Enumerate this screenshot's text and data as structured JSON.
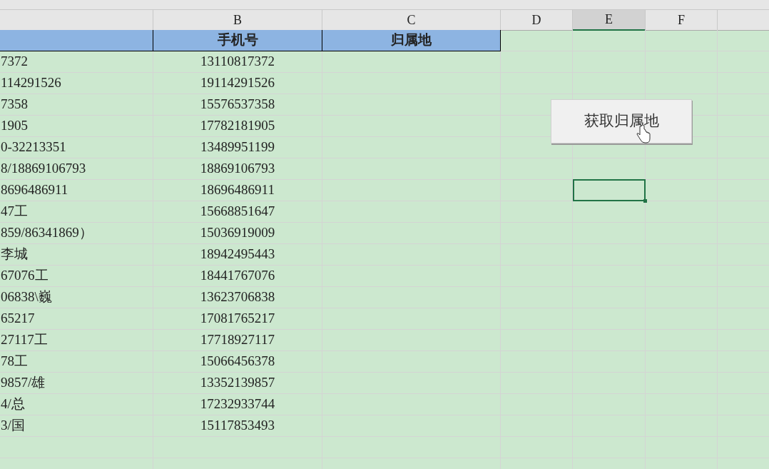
{
  "column_headers": [
    {
      "label": "B",
      "selected": false
    },
    {
      "label": "C",
      "selected": false
    },
    {
      "label": "D",
      "selected": false
    },
    {
      "label": "E",
      "selected": true
    },
    {
      "label": "F",
      "selected": false
    }
  ],
  "header_row": {
    "column_b": "手机号",
    "column_c": "归属地"
  },
  "rows": [
    {
      "column_a": "7372",
      "phone": "13110817372",
      "e_selected": false
    },
    {
      "column_a": "114291526",
      "phone": "19114291526",
      "e_selected": false
    },
    {
      "column_a": "7358",
      "phone": "15576537358",
      "e_selected": false
    },
    {
      "column_a": "1905",
      "phone": "17782181905",
      "e_selected": false
    },
    {
      "column_a": "0-32213351",
      "phone": "13489951199",
      "e_selected": false
    },
    {
      "column_a": "8/18869106793",
      "phone": "18869106793",
      "e_selected": false
    },
    {
      "column_a": "8696486911",
      "phone": "18696486911",
      "e_selected": true
    },
    {
      "column_a": "47工",
      "phone": "15668851647",
      "e_selected": false
    },
    {
      "column_a": "859/86341869）",
      "phone": "15036919009",
      "e_selected": false
    },
    {
      "column_a": "李城",
      "phone": "18942495443",
      "e_selected": false
    },
    {
      "column_a": "67076工",
      "phone": "18441767076",
      "e_selected": false
    },
    {
      "column_a": "06838\\巍",
      "phone": "13623706838",
      "e_selected": false
    },
    {
      "column_a": "65217",
      "phone": "17081765217",
      "e_selected": false
    },
    {
      "column_a": "27117工",
      "phone": "17718927117",
      "e_selected": false
    },
    {
      "column_a": "78工",
      "phone": "15066456378",
      "e_selected": false
    },
    {
      "column_a": "9857/雄",
      "phone": "13352139857",
      "e_selected": false
    },
    {
      "column_a": "4/总",
      "phone": "17232933744",
      "e_selected": false
    },
    {
      "column_a": "3/国",
      "phone": "15117853493",
      "e_selected": false
    }
  ],
  "macro_button": {
    "label": "获取归属地"
  }
}
